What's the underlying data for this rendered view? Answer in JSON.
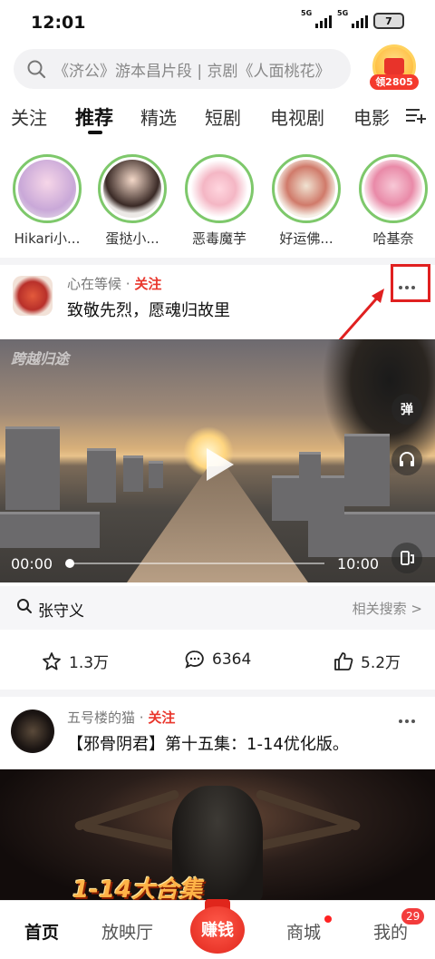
{
  "status_bar": {
    "time": "12:01",
    "signal1_label": "5G",
    "signal2_label": "5G",
    "battery": "7"
  },
  "search": {
    "placeholder": "《济公》游本昌片段 | 京剧《人面桃花》"
  },
  "reward": {
    "label": "领2805"
  },
  "tabs": [
    {
      "label": "关注",
      "active": false
    },
    {
      "label": "推荐",
      "active": true
    },
    {
      "label": "精选",
      "active": false
    },
    {
      "label": "短剧",
      "active": false
    },
    {
      "label": "电视剧",
      "active": false
    },
    {
      "label": "电影",
      "active": false
    }
  ],
  "stories": [
    {
      "name": "Hikari小..."
    },
    {
      "name": "蛋挞小..."
    },
    {
      "name": "恶毒魔芋"
    },
    {
      "name": "好运佛..."
    },
    {
      "name": "哈基奈"
    }
  ],
  "post1": {
    "author": "心在等候",
    "follow": "关注",
    "title": "致敬先烈，愿魂归故里",
    "watermark": "跨越归途",
    "current_time": "00:00",
    "duration": "10:00",
    "progress": 0.0,
    "side_icons": [
      "弹幕",
      "headphones-icon",
      "rotate-icon"
    ],
    "danmaku_label": "弹",
    "related_keyword": "张守义",
    "related_label": "相关搜索 >",
    "favorites": "1.3万",
    "comments": "6364",
    "likes": "5.2万"
  },
  "post2": {
    "author": "五号楼的猫",
    "follow": "关注",
    "title": "【邪骨阴君】第十五集：1-14优化版。",
    "overlay_text": "1-14大合集"
  },
  "bottom_nav": {
    "home": "首页",
    "cinema": "放映厅",
    "earn": "赚钱",
    "mall": "商城",
    "mine": "我的",
    "mine_badge": "29"
  },
  "colors": {
    "accent": "#e9362c",
    "story_ring": "#7ec86b",
    "highlight": "#e02020"
  }
}
